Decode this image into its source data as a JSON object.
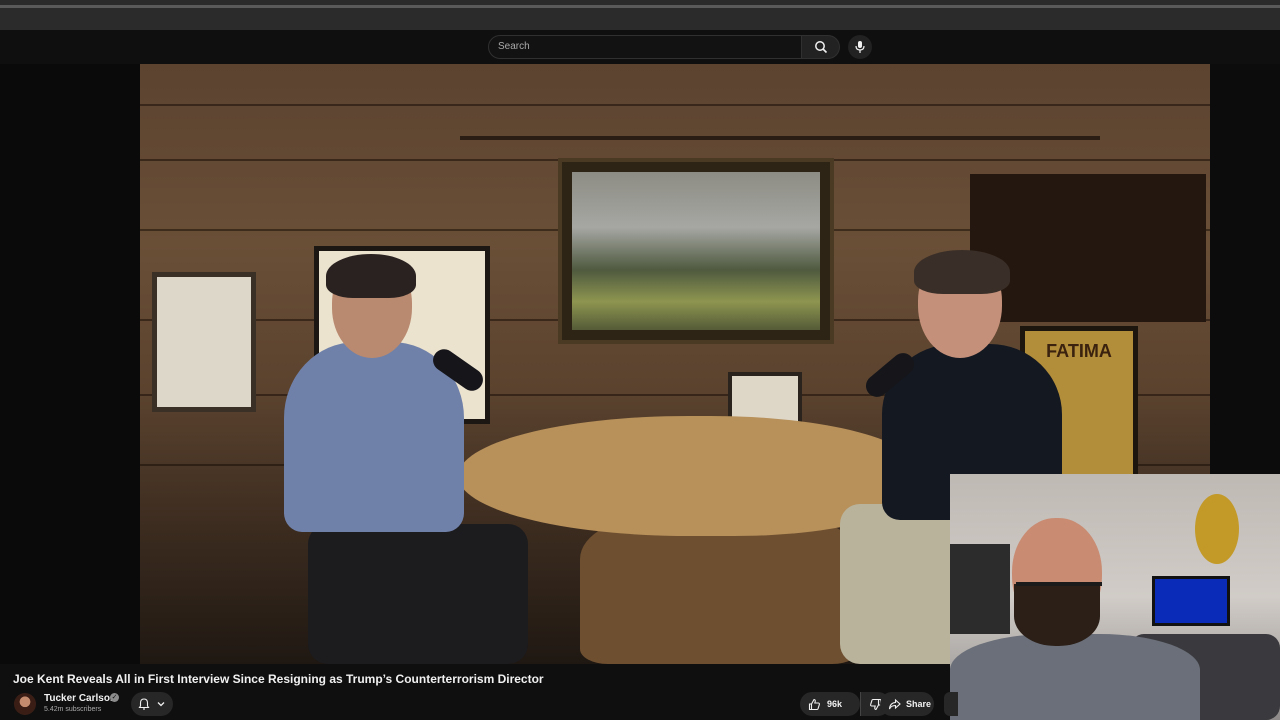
{
  "search": {
    "placeholder": "Search"
  },
  "video": {
    "title": "Joe Kent Reveals All in First Interview Since Resigning as Trump’s Counterterrorism Director",
    "poster_text": "FATIMA"
  },
  "channel": {
    "name": "Tucker Carlson",
    "subscribers": "5.42m subscribers",
    "verified": true
  },
  "actions": {
    "likes": "96k",
    "share_label": "Share"
  },
  "icons": {
    "search": "search-icon",
    "mic": "mic-icon",
    "bell": "bell-icon",
    "chevron": "chevron-down-icon",
    "like": "thumbs-up-icon",
    "dislike": "thumbs-down-icon",
    "share": "share-icon",
    "verified": "verified-check-icon"
  },
  "colors": {
    "background": "#0f0f0f",
    "pill": "#272727",
    "text_primary": "#f1f1f1",
    "text_secondary": "#aaaaaa"
  }
}
